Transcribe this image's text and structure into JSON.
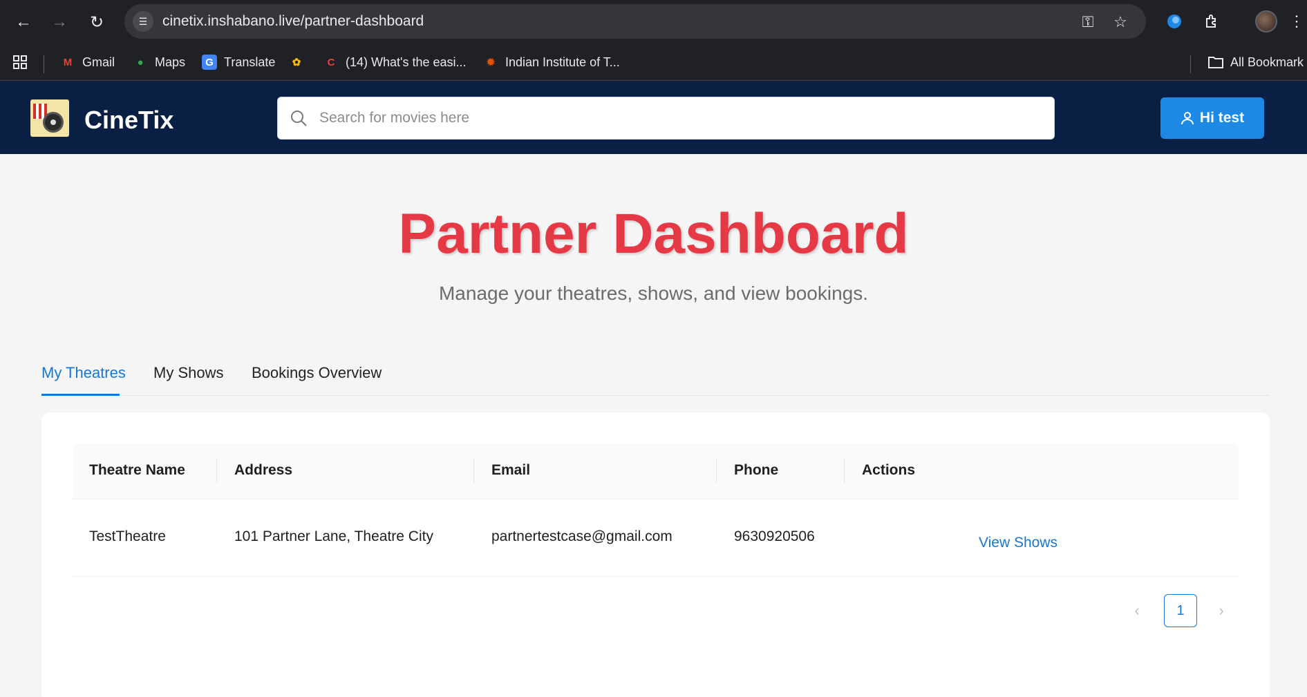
{
  "browser": {
    "url": "cinetix.inshabano.live/partner-dashboard",
    "bookmarks": [
      {
        "label": "Gmail",
        "icon": "gmail-icon"
      },
      {
        "label": "Maps",
        "icon": "maps-icon"
      },
      {
        "label": "Translate",
        "icon": "translate-icon"
      },
      {
        "label": "",
        "icon": "photos-icon"
      },
      {
        "label": "(14) What's the easi...",
        "icon": "quora-icon"
      },
      {
        "label": "Indian Institute of T...",
        "icon": "institute-icon"
      }
    ],
    "all_bookmarks": "All Bookmark"
  },
  "header": {
    "brand": "CineTix",
    "search_placeholder": "Search for movies here",
    "user_button": "Hi test"
  },
  "page": {
    "title": "Partner Dashboard",
    "subtitle": "Manage your theatres, shows, and view bookings."
  },
  "tabs": [
    {
      "label": "My Theatres",
      "active": true
    },
    {
      "label": "My Shows",
      "active": false
    },
    {
      "label": "Bookings Overview",
      "active": false
    }
  ],
  "table": {
    "columns": [
      "Theatre Name",
      "Address",
      "Email",
      "Phone",
      "Actions"
    ],
    "rows": [
      {
        "name": "TestTheatre",
        "address": "101 Partner Lane, Theatre City",
        "email": "partnertestcase@gmail.com",
        "phone": "9630920506",
        "action": "View Shows"
      }
    ]
  },
  "pagination": {
    "current": "1"
  },
  "colors": {
    "accent": "#1677d2",
    "title": "#e63946",
    "header_bg": "#0a1f44",
    "button": "#1e88e5"
  }
}
